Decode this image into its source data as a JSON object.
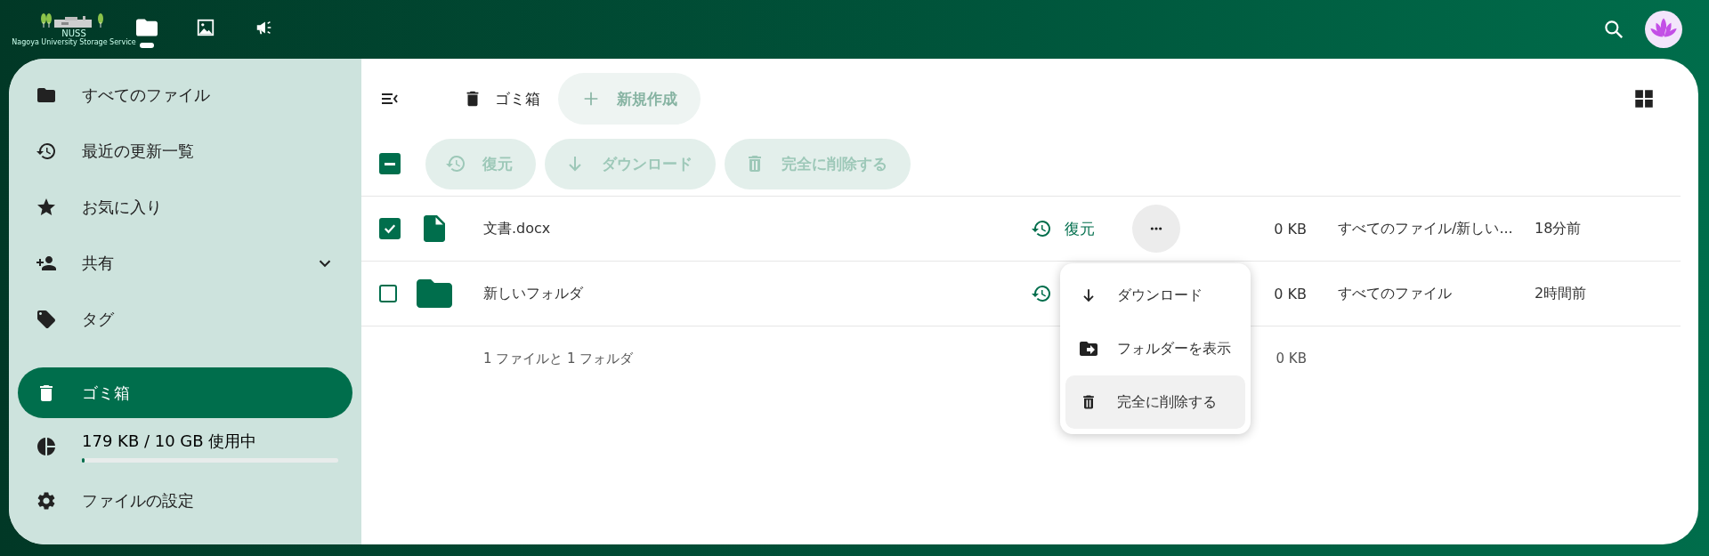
{
  "header": {
    "logo": {
      "title": "NUSS",
      "subtitle": "Nagoya University Storage Service"
    },
    "apps": [
      {
        "kind": "files",
        "selected": true
      },
      {
        "kind": "photos",
        "selected": false
      },
      {
        "kind": "activity",
        "selected": false
      }
    ]
  },
  "sidebar": {
    "items": [
      {
        "kind": "files",
        "label": "すべてのファイル",
        "selected": false,
        "expandable": false
      },
      {
        "kind": "recent",
        "label": "最近の更新一覧",
        "selected": false,
        "expandable": false
      },
      {
        "kind": "favorites",
        "label": "お気に入り",
        "selected": false,
        "expandable": false
      },
      {
        "kind": "shared",
        "label": "共有",
        "selected": false,
        "expandable": true
      },
      {
        "kind": "tags",
        "label": "タグ",
        "selected": false,
        "expandable": false
      },
      {
        "kind": "trash",
        "label": "ゴミ箱",
        "selected": true,
        "expandable": false
      }
    ],
    "quota": {
      "label": "179 KB / 10 GB 使用中",
      "level": 0.01
    },
    "settings": "ファイルの設定"
  },
  "toolbar": {
    "breadcrumb": "ゴミ箱",
    "new_button": {
      "label": "新規作成",
      "disabled": true
    }
  },
  "bulk": {
    "select_all": {
      "indeterminate": true
    },
    "actions": [
      {
        "kind": "restore",
        "label": "復元"
      },
      {
        "kind": "download",
        "label": "ダウンロード"
      },
      {
        "kind": "delete",
        "label": "完全に削除する"
      }
    ]
  },
  "rows": [
    {
      "kind": "file",
      "name": "文書.docx",
      "selected": true,
      "restore_label": "復元",
      "menu_open": true,
      "size": "0 KB",
      "location": "すべてのファイル/新しい...",
      "deleted": "18分前"
    },
    {
      "kind": "folder",
      "name": "新しいフォルダ",
      "selected": false,
      "menu_open": false,
      "size": "0 KB",
      "location": "すべてのファイル",
      "deleted": "2時間前"
    }
  ],
  "summary": {
    "label": "1 ファイルと 1 フォルダ",
    "size": "0 KB"
  },
  "menu": [
    {
      "kind": "download",
      "label": "ダウンロード",
      "highlighted": false
    },
    {
      "kind": "show",
      "label": "フォルダーを表示",
      "highlighted": false
    },
    {
      "kind": "delete",
      "label": "完全に削除する",
      "highlighted": true
    }
  ]
}
